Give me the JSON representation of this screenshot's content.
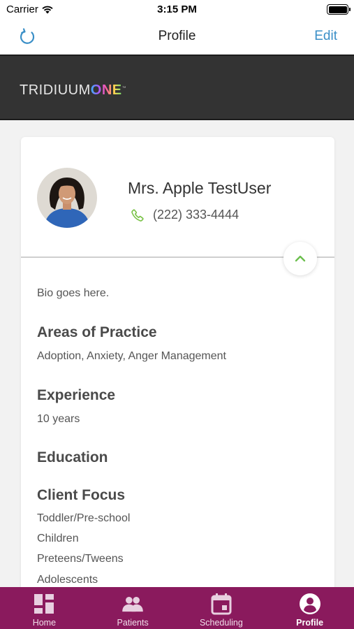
{
  "status_bar": {
    "carrier": "Carrier",
    "time": "3:15 PM"
  },
  "nav": {
    "title": "Profile",
    "edit_label": "Edit",
    "left_icon": "refresh-icon"
  },
  "banner": {
    "logo_part1": "TRIDIUUM",
    "logo_part2": "ONE",
    "logo_tm": "™"
  },
  "profile": {
    "name": "Mrs. Apple TestUser",
    "phone": "(222) 333-4444",
    "bio": "Bio goes here.",
    "areas_title": "Areas of Practice",
    "areas_text": "Adoption, Anxiety, Anger Management",
    "experience_title": "Experience",
    "experience_text": "10 years",
    "education_title": "Education",
    "client_focus_title": "Client Focus",
    "client_focus": [
      "Toddler/Pre-school",
      "Children",
      "Preteens/Tweens",
      "Adolescents"
    ]
  },
  "tabs": [
    {
      "label": "Home",
      "icon": "dashboard-icon",
      "active": false
    },
    {
      "label": "Patients",
      "icon": "people-icon",
      "active": false
    },
    {
      "label": "Scheduling",
      "icon": "calendar-icon",
      "active": false
    },
    {
      "label": "Profile",
      "icon": "user-circle-icon",
      "active": true
    }
  ],
  "colors": {
    "accent": "#3a8fc7",
    "tab_bar": "#8a1a5d",
    "banner": "#333333",
    "phone_icon": "#7cc34a",
    "collapse_chevron": "#6cbf4e"
  }
}
